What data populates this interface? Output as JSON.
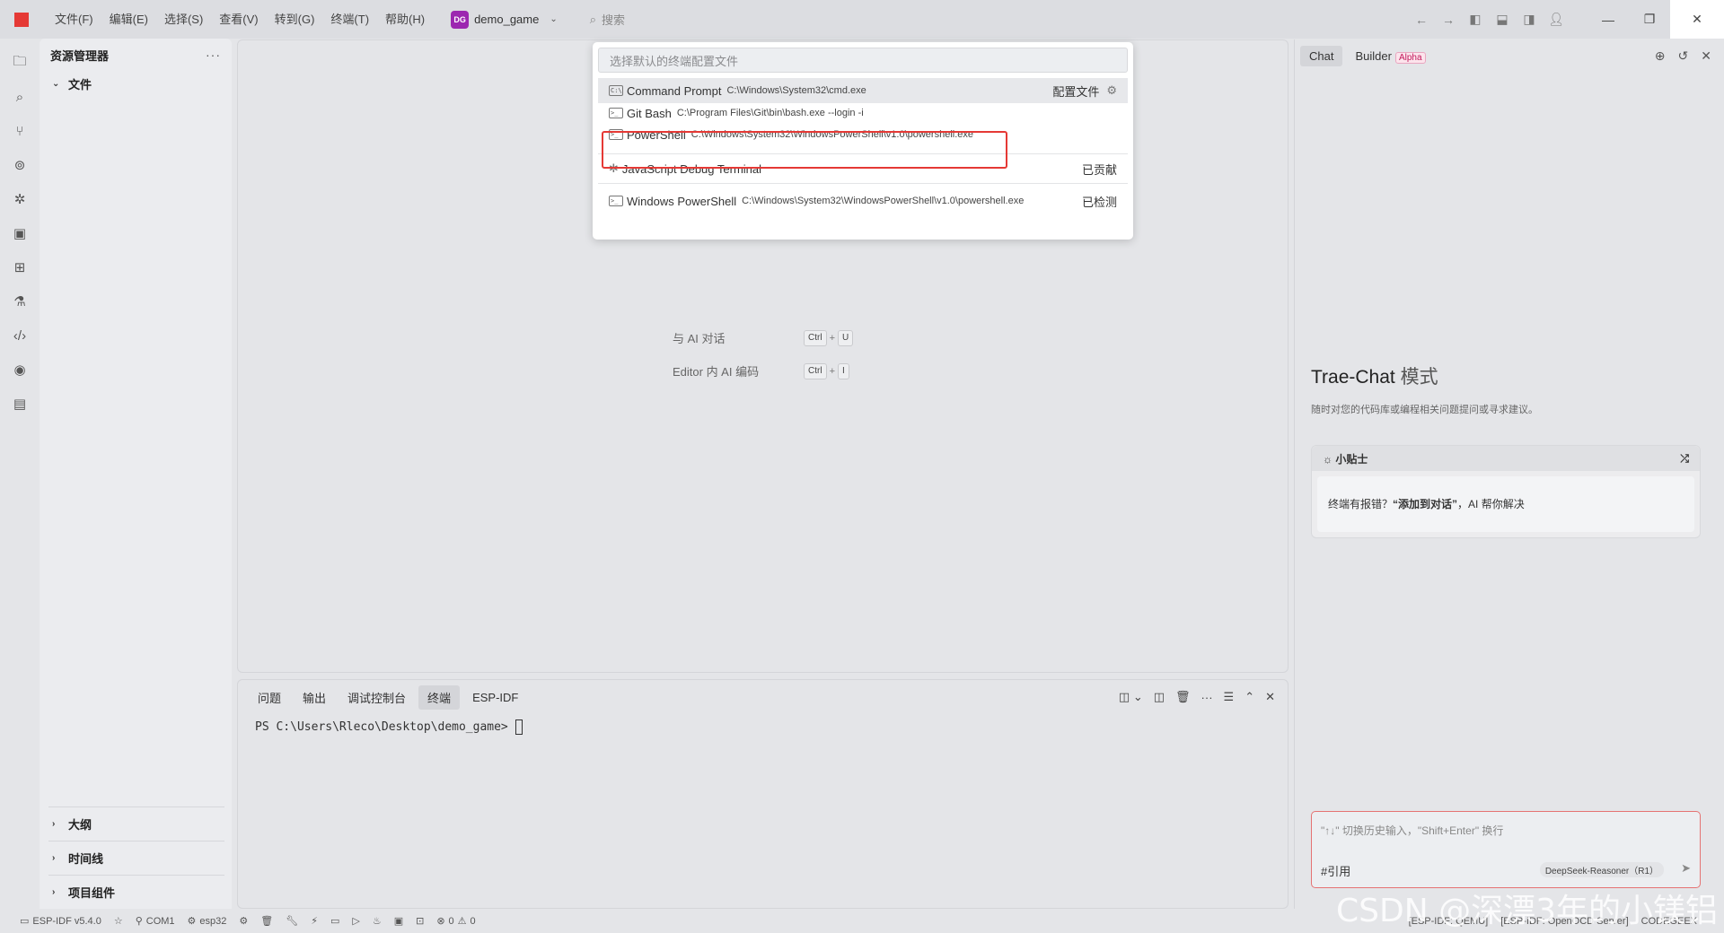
{
  "titlebar": {
    "menus": [
      "文件(F)",
      "编辑(E)",
      "选择(S)",
      "查看(V)",
      "转到(G)",
      "终端(T)",
      "帮助(H)"
    ],
    "project_badge": "DG",
    "project_name": "demo_game",
    "search_placeholder": "搜索"
  },
  "explorer": {
    "title": "资源管理器",
    "more": "···",
    "root": "文件",
    "sections": [
      "大纲",
      "时间线",
      "项目组件"
    ]
  },
  "editor": {
    "shortcuts": [
      {
        "label": "与 AI 对话",
        "keys": [
          "Ctrl",
          "U"
        ]
      },
      {
        "label": "Editor 内 AI 编码",
        "keys": [
          "Ctrl",
          "I"
        ]
      }
    ]
  },
  "quickpick": {
    "placeholder": "选择默认的终端配置文件",
    "items": [
      {
        "name": "Command Prompt",
        "path": "C:\\Windows\\System32\\cmd.exe",
        "right": "配置文件"
      },
      {
        "name": "Git Bash",
        "path": "C:\\Program Files\\Git\\bin\\bash.exe --login -i",
        "right": ""
      },
      {
        "name": "PowerShell",
        "path": "C:\\Windows\\System32\\WindowsPowerShell\\v1.0\\powershell.exe",
        "right": ""
      },
      {
        "name": "JavaScript Debug Terminal",
        "path": "",
        "right": "已贡献"
      },
      {
        "name": "Windows PowerShell",
        "path": "C:\\Windows\\System32\\WindowsPowerShell\\v1.0\\powershell.exe",
        "right": "已检测"
      }
    ]
  },
  "panel": {
    "tabs": [
      "问题",
      "输出",
      "调试控制台",
      "终端",
      "ESP-IDF"
    ],
    "active_tab": "终端",
    "prompt": "PS C:\\Users\\Rleco\\Desktop\\demo_game>"
  },
  "chat": {
    "tabs": [
      "Chat",
      "Builder"
    ],
    "alpha_badge": "Alpha",
    "title_main": "Trae-Chat",
    "title_mode": "模式",
    "description": "随时对您的代码库或编程相关问题提问或寻求建议。",
    "tips_title": "小贴士",
    "tips_body_prefix": "终端有报错？",
    "tips_body_bold": "“添加到对话”",
    "tips_body_suffix": "，AI 帮你解决",
    "input_placeholder": "\"↑↓\" 切换历史输入，\"Shift+Enter\" 换行",
    "ref_label": "#引用",
    "model": "DeepSeek-Reasoner（R1）"
  },
  "statusbar": {
    "esp_idf": "ESP-IDF v5.4.0",
    "port": "COM1",
    "target": "esp32",
    "problems": "0",
    "warnings": "0",
    "right_items": [
      "[ESP-IDF: QEMU]",
      "[ESP-IDF: OpenOCD Server]",
      "CODEGEEX"
    ]
  },
  "watermark": "CSDN @深漂3年的小镁铝"
}
